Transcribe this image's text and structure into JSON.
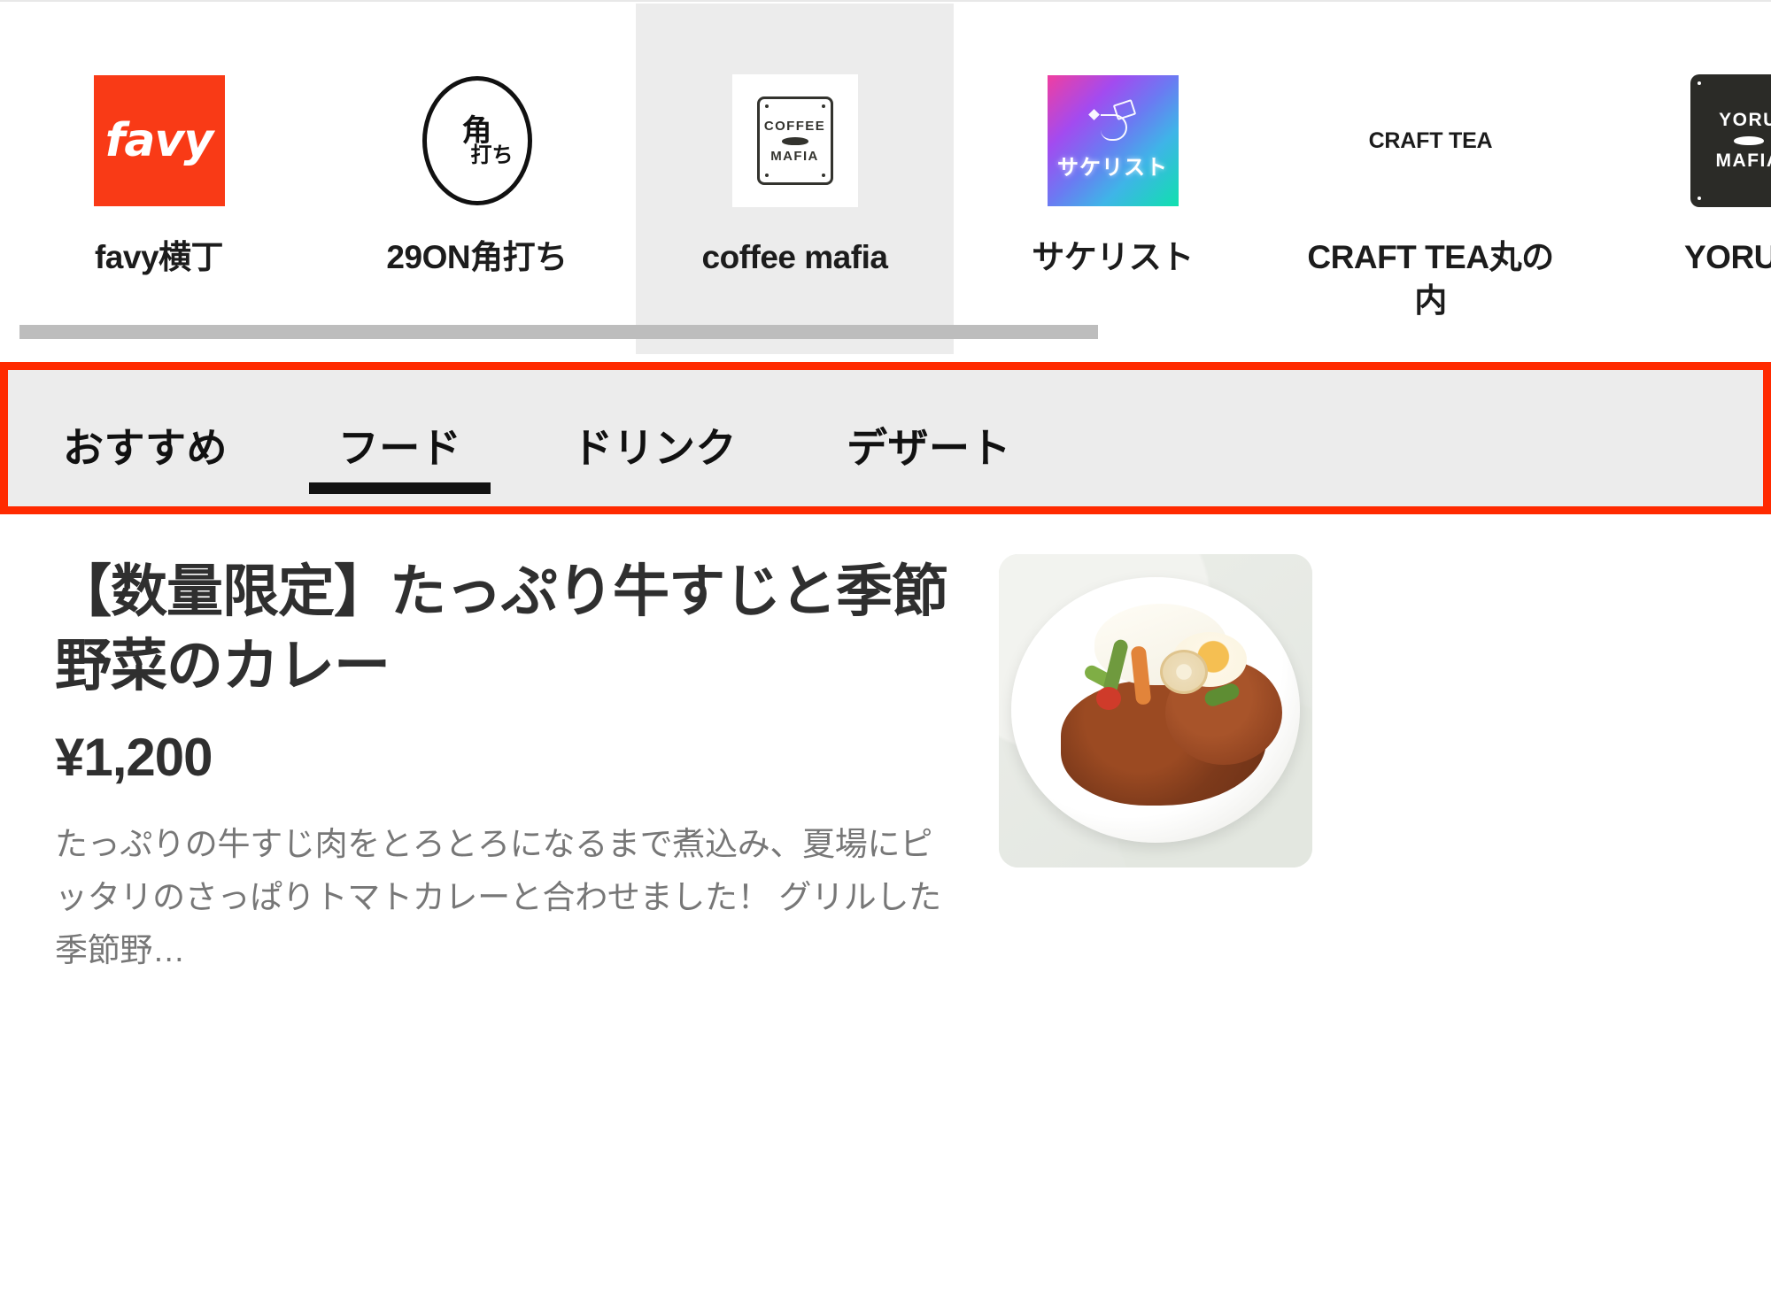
{
  "brand_strip": {
    "selected_brand": "coffee mafia",
    "brands": [
      {
        "label": "favy横丁",
        "logo_icon": "favy-logo-icon",
        "logo_text": "favy"
      },
      {
        "label": "29ON角打ち",
        "logo_icon": "29on-kakuuchi-logo-icon",
        "logo_text": "角打ち"
      },
      {
        "label": "coffee mafia",
        "logo_icon": "coffee-mafia-logo-icon",
        "logo_text_1": "COFFEE",
        "logo_text_2": "MAFIA"
      },
      {
        "label": "サケリスト",
        "logo_icon": "sakelist-logo-icon",
        "logo_text": "サケリスト"
      },
      {
        "label": "CRAFT TEA丸の内",
        "logo_icon": "craft-tea-logo-icon",
        "logo_text": "CRAFT TEA"
      },
      {
        "label": "YORU M",
        "logo_icon": "yoru-mafia-logo-icon",
        "logo_text_1": "YORU",
        "logo_text_2": "MAFIA"
      }
    ]
  },
  "scrollbar": {
    "orientation": "horizontal",
    "thumb_color": "#bdbdbd"
  },
  "tabbar": {
    "highlight_color": "#ff2a00",
    "background_color": "#ececec",
    "active_tab": "フード",
    "tabs": [
      {
        "label": "おすすめ",
        "active": false
      },
      {
        "label": "フード",
        "active": true
      },
      {
        "label": "ドリンク",
        "active": false
      },
      {
        "label": "デザート",
        "active": false
      }
    ]
  },
  "menu_item": {
    "title": "【数量限定】たっぷり牛すじと季節野菜のカレー",
    "price": "¥1,200",
    "description": "たっぷりの牛すじ肉をとろとろになるまで煮込み、夏場にピッタリのさっぱりトマトカレーと合わせました！ グリルした季節野…",
    "photo_alt": "curry-dish-photo"
  }
}
